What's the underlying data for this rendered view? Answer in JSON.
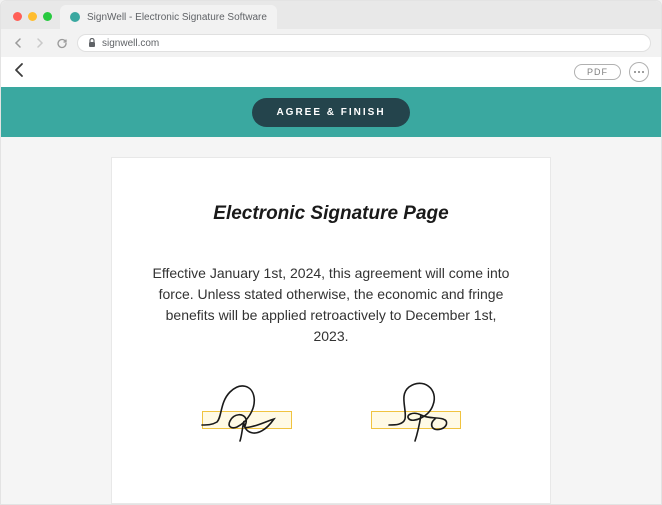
{
  "browser": {
    "tab_title": "SignWell - Electronic Signature Software",
    "url": "signwell.com"
  },
  "header": {
    "pdf_label": "PDF"
  },
  "banner": {
    "agree_label": "AGREE & FINISH"
  },
  "document": {
    "title": "Electronic Signature Page",
    "body": "Effective January 1st, 2024, this agreement will come into force. Unless stated otherwise, the economic and fringe benefits will be applied retroactively to December 1st, 2023."
  }
}
